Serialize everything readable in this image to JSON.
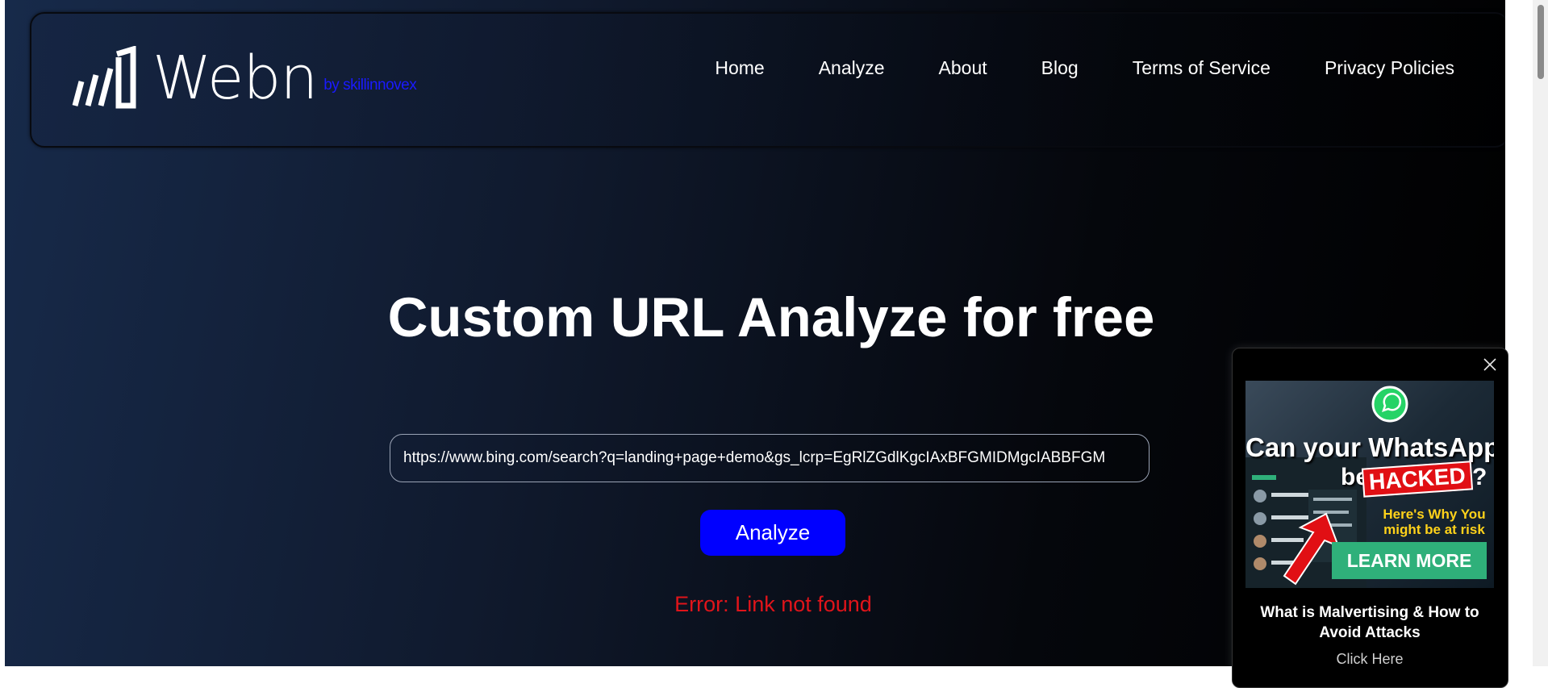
{
  "brand": {
    "name": "Webn",
    "byline": "by skillinnovex",
    "byline_color": "#1a1aff"
  },
  "nav": {
    "items": [
      {
        "label": "Home"
      },
      {
        "label": "Analyze"
      },
      {
        "label": "About"
      },
      {
        "label": "Blog"
      },
      {
        "label": "Terms of Service"
      },
      {
        "label": "Privacy Policies"
      }
    ]
  },
  "hero": {
    "title": "Custom URL Analyze for free"
  },
  "form": {
    "url_value": "https://www.bing.com/search?q=landing+page+demo&gs_lcrp=EgRlZGdlKgcIAxBFGMIDMgcIABBFGM",
    "analyze_label": "Analyze",
    "button_color": "#0000ff"
  },
  "status": {
    "error": "Error: Link not found",
    "error_color": "#e0141a"
  },
  "ad": {
    "close_icon": "close-icon",
    "headline_line1": "Can your WhatsApp",
    "headline_be": "be",
    "headline_hacked": "HACKED",
    "headline_q": "?",
    "subhead": "Here's Why You might be at risk",
    "learn_more": "LEARN MORE",
    "title": "What is Malvertising & How to Avoid Attacks",
    "cta": "Click Here",
    "accent_green": "#2fb07a",
    "accent_red": "#e10f14",
    "accent_yellow": "#ffd21a"
  }
}
